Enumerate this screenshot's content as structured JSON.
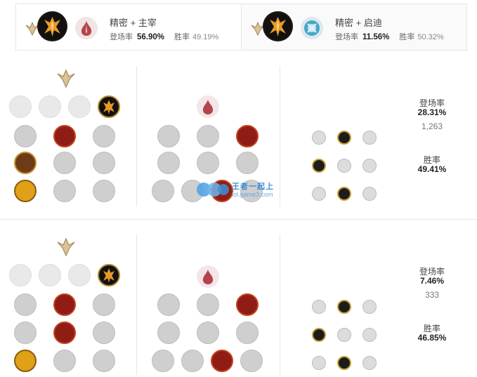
{
  "summary": [
    {
      "title": "精密 + 主宰",
      "pick_label": "登场率",
      "pick_rate": "56.90%",
      "win_label": "胜率",
      "win_rate": "49.19%"
    },
    {
      "title": "精密 + 启迪",
      "pick_label": "登场率",
      "pick_rate": "11.56%",
      "win_label": "胜率",
      "win_rate": "50.32%"
    }
  ],
  "builds": [
    {
      "pick_label": "登场率",
      "pick_rate": "28.31%",
      "games": "1,263",
      "win_label": "胜率",
      "win_rate": "49.41%"
    },
    {
      "pick_label": "登场率",
      "pick_rate": "7.46%",
      "games": "333",
      "win_label": "胜率",
      "win_rate": "46.85%"
    }
  ],
  "watermark": {
    "brand": "王者一起上",
    "url": "lol.game3.com"
  },
  "icons": {
    "primary_path": "precision-icon",
    "secondary_path_dom": "domination-icon",
    "secondary_path_insp": "inspiration-icon",
    "keystone": "conqueror-icon"
  },
  "colors": {
    "gold": "#b8862b",
    "domination_red": "#c2421d",
    "inspiration_blue": "#48a6c7"
  }
}
